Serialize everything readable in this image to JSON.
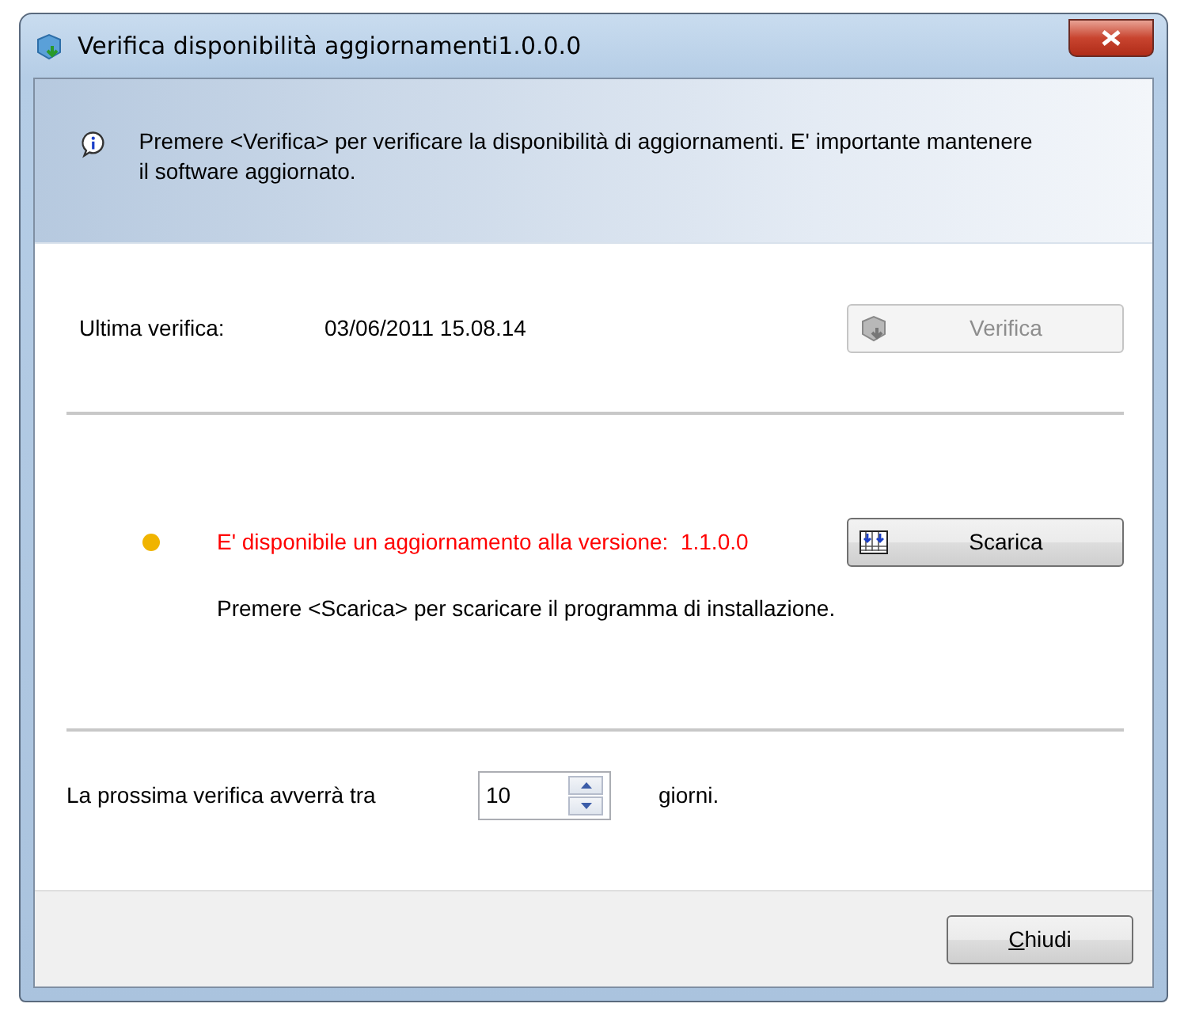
{
  "window": {
    "title": "Verifica disponibilità aggiornamenti1.0.0.0"
  },
  "header": {
    "message": "Premere <Verifica> per verificare la disponibilità di aggiornamenti. E' importante mantenere il software aggiornato."
  },
  "last_check": {
    "label": "Ultima verifica:",
    "value": "03/06/2011 15.08.14",
    "button": {
      "label": "Verifica",
      "disabled": true
    }
  },
  "update": {
    "color": "#f0b400",
    "message": "E' disponibile un aggiornamento alla versione:  1.1.0.0",
    "button": {
      "label": "Scarica",
      "disabled": false
    },
    "hint": "Premere <Scarica> per scaricare il programma di installazione."
  },
  "next_check": {
    "label": "La prossima verifica avverrà tra",
    "value": "10",
    "unit": "giorni."
  },
  "buttons": [
    {
      "label": "Chiudi",
      "disabled": false
    }
  ]
}
